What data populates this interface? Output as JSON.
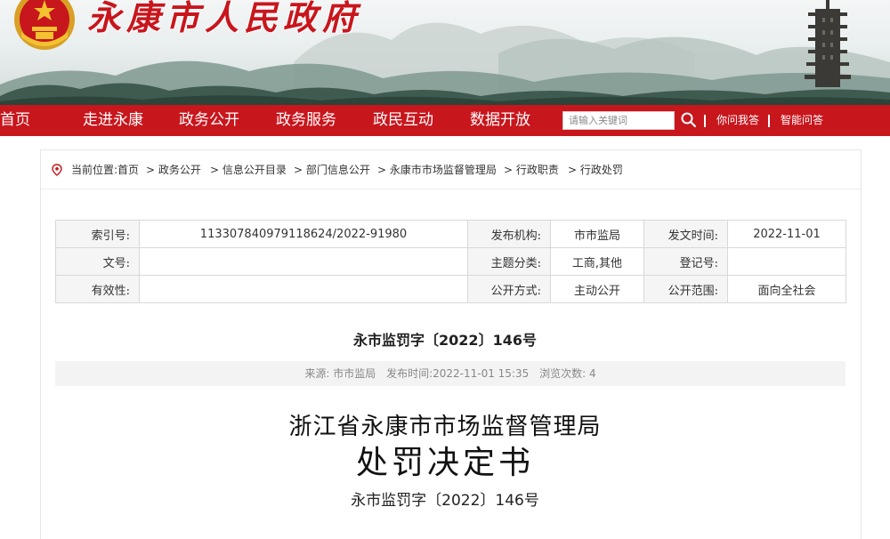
{
  "site": {
    "title": "永康市人民政府"
  },
  "nav": {
    "items": [
      "首页",
      "走进永康",
      "政务公开",
      "政务服务",
      "政民互动",
      "数据开放"
    ],
    "search_placeholder": "请输入关键词",
    "links": [
      "你问我答",
      "智能问答"
    ]
  },
  "breadcrumb": {
    "label": "当前位置:首页",
    "items": [
      "> 政务公开",
      "> 信息公开目录",
      "> 部门信息公开",
      "> 永康市市场监督管理局",
      "> 行政职责",
      "> 行政处罚"
    ]
  },
  "info_table": {
    "rows": [
      [
        {
          "label": "索引号:",
          "value": "113307840979118624/2022-91980"
        },
        {
          "label": "发布机构:",
          "value": "市市监局"
        },
        {
          "label": "发文时间:",
          "value": "2022-11-01"
        }
      ],
      [
        {
          "label": "文号:",
          "value": ""
        },
        {
          "label": "主题分类:",
          "value": "工商,其他"
        },
        {
          "label": "登记号:",
          "value": ""
        }
      ],
      [
        {
          "label": "有效性:",
          "value": ""
        },
        {
          "label": "公开方式:",
          "value": "主动公开"
        },
        {
          "label": "公开范围:",
          "value": "面向全社会"
        }
      ]
    ]
  },
  "article": {
    "heading": "永市监罚字〔2022〕146号",
    "meta": {
      "source": "来源: 市市监局",
      "published": "发布时间:2022-11-01  15:35",
      "views_label": "浏览次数:",
      "views": "4"
    },
    "agency": "浙江省永康市市场监督管理局",
    "doc_kind": "处罚决定书",
    "doc_no": "永市监罚字〔2022〕146号"
  },
  "colors": {
    "brand_red": "#c8161d",
    "label_bg": "#f5f5f5"
  },
  "icons": [
    "national-emblem-icon",
    "search-icon",
    "location-pin-icon"
  ]
}
